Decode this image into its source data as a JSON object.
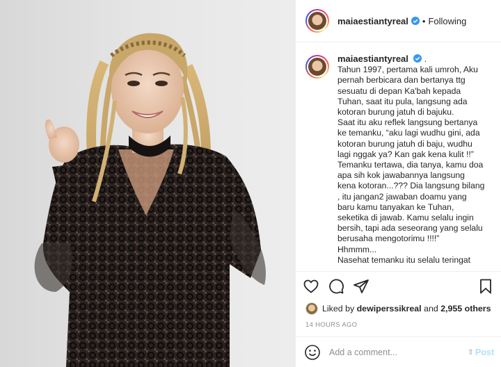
{
  "post": {
    "username": "maiaestiantyreal",
    "verified": true,
    "follow_status": "Following",
    "separator": "•",
    "caption_username": "maiaestiantyreal",
    "caption_suffix": ".",
    "caption_text": "Tahun 1997, pertama kali umroh, Aku pernah berbicara dan bertanya ttg sesuatu di depan Ka'bah kepada Tuhan, saat itu pula, langsung ada kotoran burung jatuh di bajuku.\nSaat itu aku reflek langsung bertanya ke temanku, “aku lagi wudhu gini, ada kotoran burung jatuh di baju, wudhu lagi nggak ya? Kan gak kena kulit !!”\nTemanku tertawa, dia tanya, kamu doa apa sih kok jawabannya langsung kena kotoran...??? Dia langsung bilang , itu jangan2 jawaban doamu yang baru kamu tanyakan ke Tuhan, seketika di jawab. Kamu selalu ingin bersih, tapi ada seseorang yang selalu berusaha mengotorimu !!!!”\nHhmmm...\nNasehat temanku itu selalu teringat"
  },
  "likes": {
    "prefix": "Liked by",
    "liker": "dewiperssikreal",
    "joiner": "and",
    "others": "2,955 others"
  },
  "timestamp": "14 HOURS AGO",
  "comment_box": {
    "placeholder": "Add a comment...",
    "post_label": "Post",
    "emoji_icon": "smiley-icon"
  },
  "icons": [
    "heart-icon",
    "comment-icon",
    "share-icon",
    "bookmark-icon",
    "verified-badge-icon"
  ],
  "colors": {
    "verified_blue": "#3897f0",
    "post_button_disabled": "#b2dffc",
    "muted": "#8e8e8e",
    "border": "#efefef"
  }
}
